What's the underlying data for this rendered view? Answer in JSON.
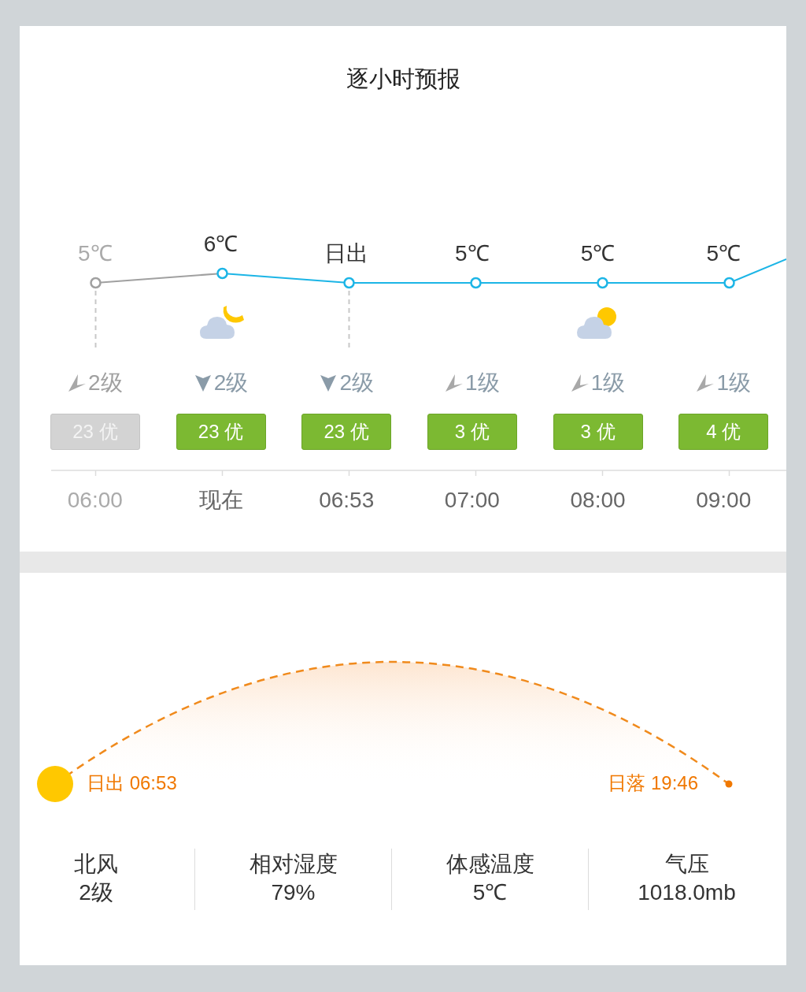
{
  "title": "逐小时预报",
  "hours": [
    {
      "temp": "5℃",
      "past": true,
      "guide": true,
      "wind": {
        "kind": "southwest",
        "text": "2级"
      },
      "aqi": "23 优",
      "time": "06:00"
    },
    {
      "temp": "6℃",
      "past": false,
      "guide": false,
      "weather": {
        "kind": "night-cloudy"
      },
      "wind": {
        "kind": "south",
        "text": "2级"
      },
      "aqi": "23 优",
      "time": "现在"
    },
    {
      "temp": "日出",
      "past": false,
      "guide": true,
      "wind": {
        "kind": "south",
        "text": "2级"
      },
      "aqi": "23 优",
      "time": "06:53"
    },
    {
      "temp": "5℃",
      "past": false,
      "guide": false,
      "wind": {
        "kind": "southwest",
        "text": "1级"
      },
      "aqi": "3 优",
      "time": "07:00"
    },
    {
      "temp": "5℃",
      "past": false,
      "guide": false,
      "weather": {
        "kind": "day-cloudy"
      },
      "wind": {
        "kind": "southwest",
        "text": "1级"
      },
      "aqi": "3 优",
      "time": "08:00"
    },
    {
      "temp": "5℃",
      "past": false,
      "guide": false,
      "wind": {
        "kind": "southwest",
        "text": "1级"
      },
      "aqi": "4 优",
      "time": "09:00"
    }
  ],
  "sun": {
    "sunrise": "日出 06:53",
    "sunset": "日落 19:46"
  },
  "stats": [
    {
      "label": "北风",
      "value": "2级"
    },
    {
      "label": "相对湿度",
      "value": "79%"
    },
    {
      "label": "体感温度",
      "value": "5℃"
    },
    {
      "label": "气压",
      "value": "1018.0mb"
    }
  ]
}
